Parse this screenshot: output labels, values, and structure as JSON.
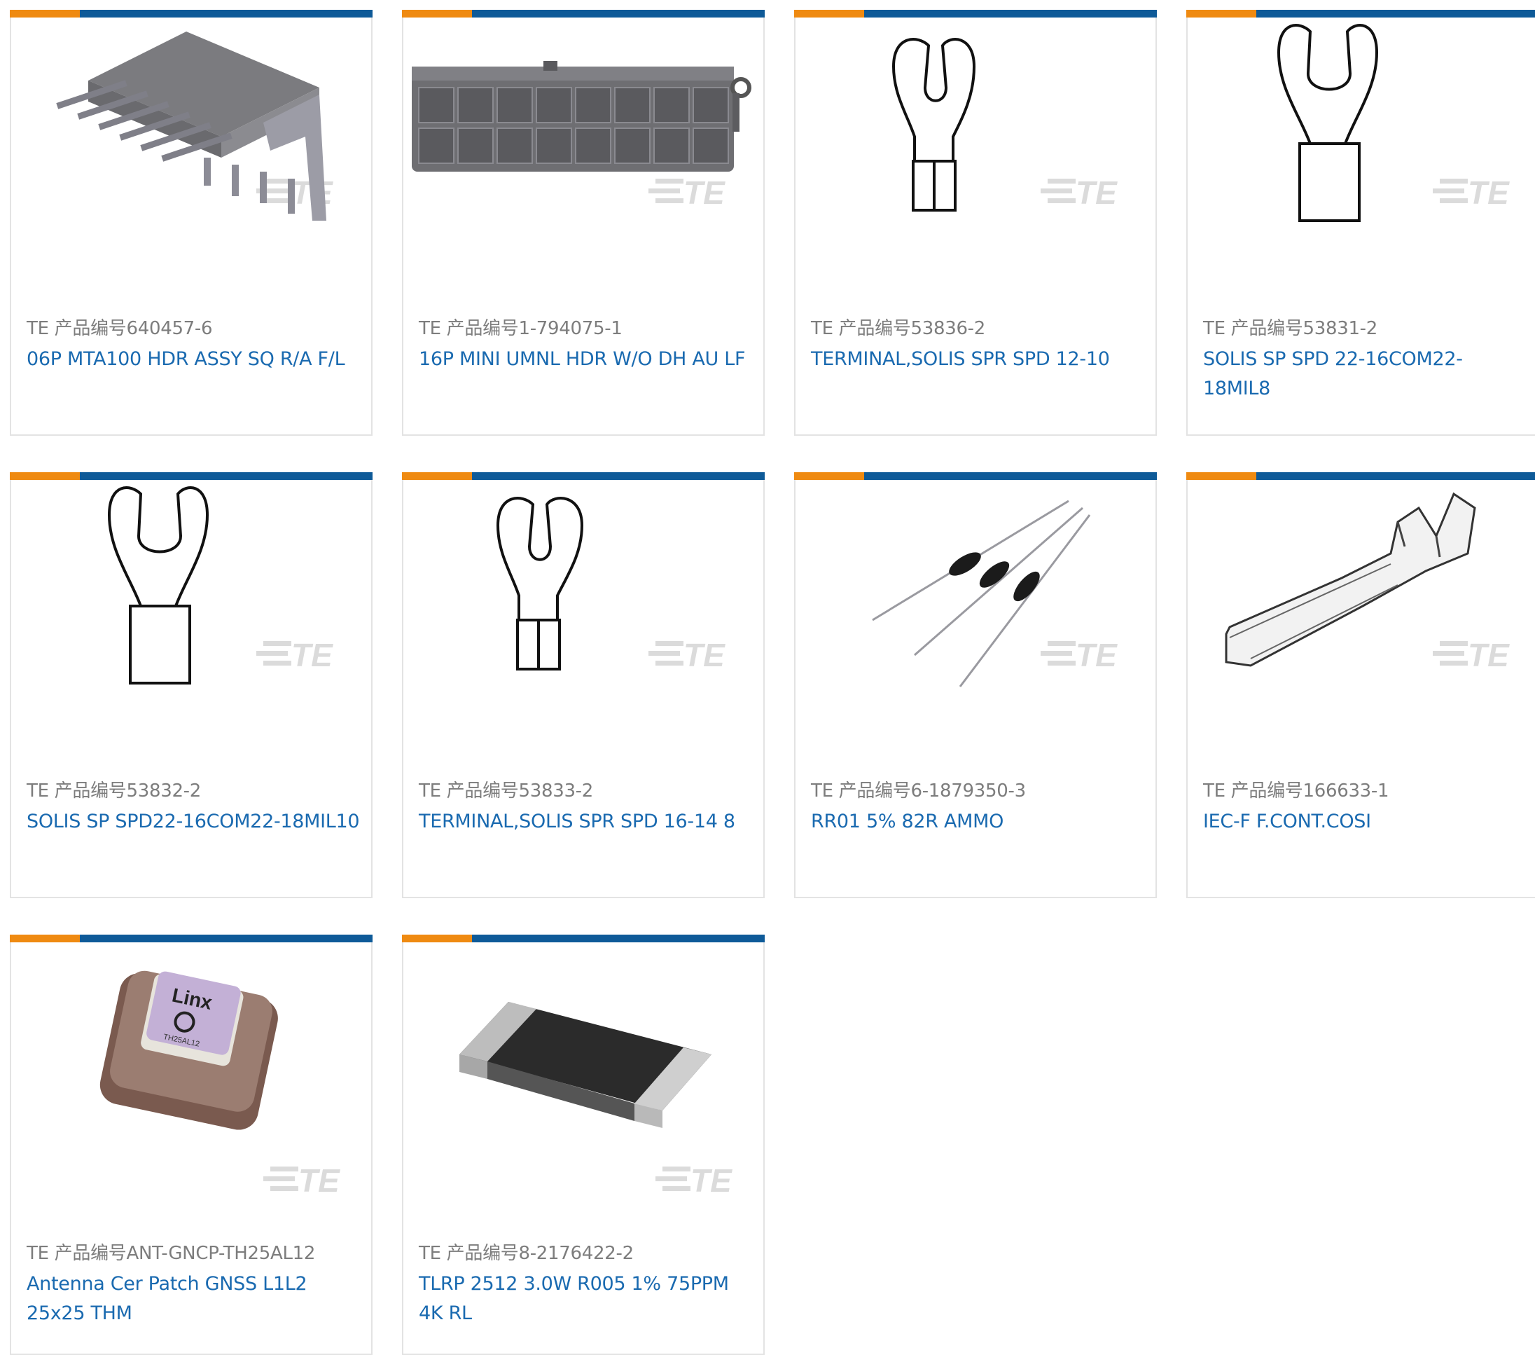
{
  "colors": {
    "accent_orange": "#ef8a11",
    "accent_blue": "#0e5a98",
    "link_blue": "#1a6ab0",
    "label_gray": "#7d7d7d",
    "border": "#e3e3e3"
  },
  "products": [
    {
      "part_label": "TE 产品编号640457-6",
      "description": "06P MTA100 HDR ASSY SQ R/A F/L",
      "image": "right-angle-header"
    },
    {
      "part_label": "TE 产品编号1-794075-1",
      "description": "16P MINI UMNL HDR W/O DH AU LF",
      "image": "mini-universal-header"
    },
    {
      "part_label": "TE 产品编号53836-2",
      "description": "TERMINAL,SOLIS SPR SPD 12-10",
      "image": "spade-terminal"
    },
    {
      "part_label": "TE 产品编号53831-2",
      "description": "SOLIS SP SPD 22-16COM22-18MIL8",
      "image": "spade-terminal"
    },
    {
      "part_label": "TE 产品编号53832-2",
      "description": "SOLIS SP SPD22-16COM22-18MIL10",
      "image": "spade-terminal"
    },
    {
      "part_label": "TE 产品编号53833-2",
      "description": "TERMINAL,SOLIS SPR SPD 16-14 8",
      "image": "spade-terminal"
    },
    {
      "part_label": "TE 产品编号6-1879350-3",
      "description": "RR01 5% 82R AMMO",
      "image": "axial-resistors"
    },
    {
      "part_label": "TE 产品编号166633-1",
      "description": "IEC-F F.CONT.COSI",
      "image": "crimp-contact"
    },
    {
      "part_label": "TE 产品编号ANT-GNCP-TH25AL12",
      "description": "Antenna Cer Patch GNSS L1L2 25x25 THM",
      "image": "patch-antenna",
      "image_text": "Linx",
      "image_subtext": "TH25AL12"
    },
    {
      "part_label": "TE 产品编号8-2176422-2",
      "description": "TLRP 2512 3.0W R005 1% 75PPM 4K RL",
      "image": "chip-resistor"
    }
  ],
  "watermark": "TE"
}
